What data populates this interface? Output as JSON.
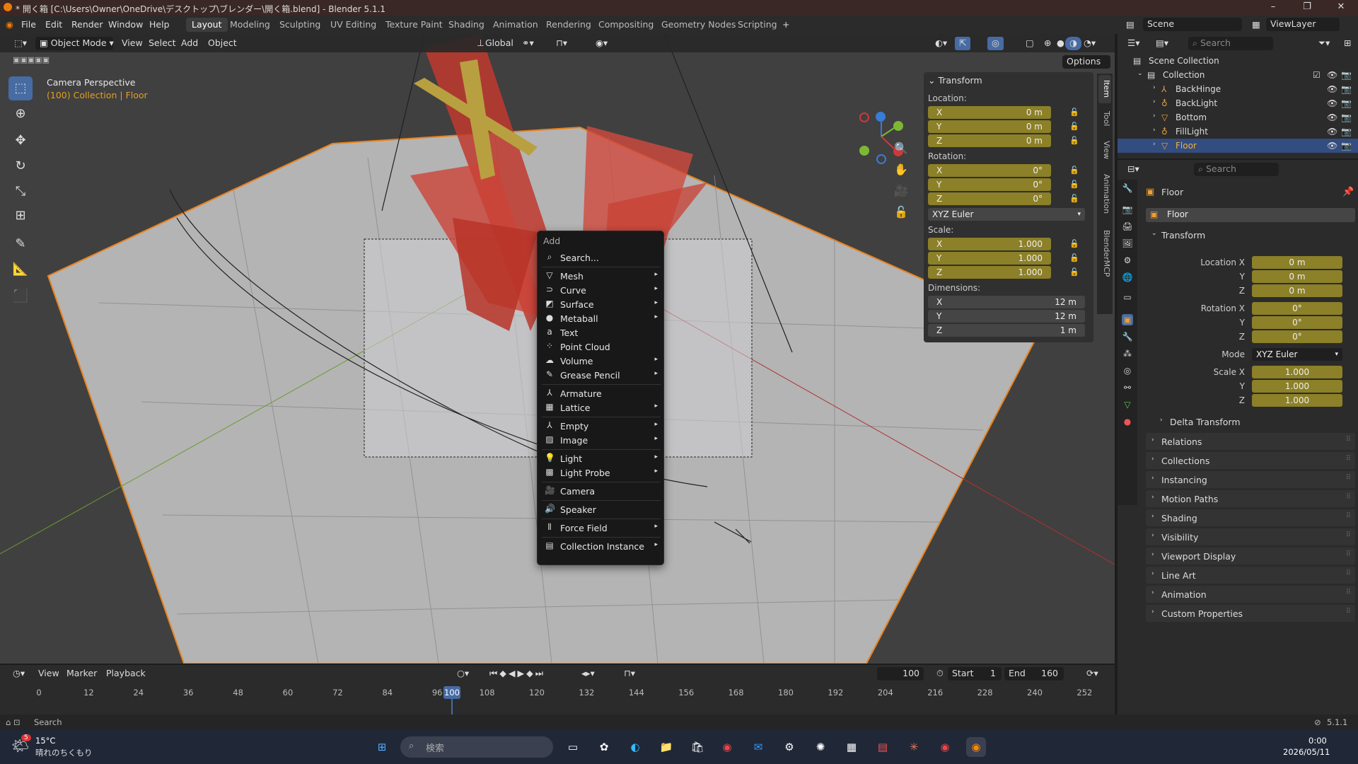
{
  "window": {
    "title": "* 開く箱 [C:\\Users\\Owner\\OneDrive\\デスクトップ\\ブレンダー\\開く箱.blend] - Blender 5.1.1"
  },
  "menubar": {
    "items": [
      "File",
      "Edit",
      "Render",
      "Window",
      "Help"
    ],
    "workspaces": [
      "Layout",
      "Modeling",
      "Sculpting",
      "UV Editing",
      "Texture Paint",
      "Shading",
      "Animation",
      "Rendering",
      "Compositing",
      "Geometry Nodes",
      "Scripting"
    ],
    "active_workspace": "Layout",
    "scene": "Scene",
    "view_layer": "ViewLayer"
  },
  "viewport_header": {
    "mode": "Object Mode",
    "menus": [
      "View",
      "Select",
      "Add",
      "Object"
    ],
    "transform_orientation": "Global",
    "options": "Options"
  },
  "viewport": {
    "camera_line": "Camera Perspective",
    "collection_line_prefix": "(100) Collection | ",
    "collection_line_object": "Floor"
  },
  "npanel": {
    "title": "Transform",
    "location_label": "Location:",
    "location": [
      {
        "axis": "X",
        "value": "0 m"
      },
      {
        "axis": "Y",
        "value": "0 m"
      },
      {
        "axis": "Z",
        "value": "0 m"
      }
    ],
    "rotation_label": "Rotation:",
    "rotation": [
      {
        "axis": "X",
        "value": "0°"
      },
      {
        "axis": "Y",
        "value": "0°"
      },
      {
        "axis": "Z",
        "value": "0°"
      }
    ],
    "rotation_mode": "XYZ Euler",
    "scale_label": "Scale:",
    "scale": [
      {
        "axis": "X",
        "value": "1.000"
      },
      {
        "axis": "Y",
        "value": "1.000"
      },
      {
        "axis": "Z",
        "value": "1.000"
      }
    ],
    "dimensions_label": "Dimensions:",
    "dimensions": [
      {
        "axis": "X",
        "value": "12 m"
      },
      {
        "axis": "Y",
        "value": "12 m"
      },
      {
        "axis": "Z",
        "value": "1 m"
      }
    ],
    "tabs": [
      "Item",
      "Tool",
      "View",
      "Animation",
      "BlenderMCP"
    ]
  },
  "add_menu": {
    "title": "Add",
    "search": "Search...",
    "items": [
      {
        "label": "Mesh",
        "sub": true
      },
      {
        "label": "Curve",
        "sub": true
      },
      {
        "label": "Surface",
        "sub": true
      },
      {
        "label": "Metaball",
        "sub": true
      },
      {
        "label": "Text",
        "sub": false
      },
      {
        "label": "Point Cloud",
        "sub": false
      },
      {
        "label": "Volume",
        "sub": true
      },
      {
        "label": "Grease Pencil",
        "sub": true
      },
      {
        "label": "Armature",
        "sub": false
      },
      {
        "label": "Lattice",
        "sub": true
      },
      {
        "label": "Empty",
        "sub": true
      },
      {
        "label": "Image",
        "sub": true
      },
      {
        "label": "Light",
        "sub": true
      },
      {
        "label": "Light Probe",
        "sub": true
      },
      {
        "label": "Camera",
        "sub": false
      },
      {
        "label": "Speaker",
        "sub": false
      },
      {
        "label": "Force Field",
        "sub": true
      },
      {
        "label": "Collection Instance",
        "sub": true
      }
    ]
  },
  "timeline": {
    "menus": [
      "View",
      "Marker",
      "Playback"
    ],
    "current_frame": "100",
    "start_label": "Start",
    "start": "1",
    "end_label": "End",
    "end": "160",
    "ticks": [
      "0",
      "12",
      "24",
      "36",
      "48",
      "60",
      "72",
      "84",
      "96",
      "108",
      "120",
      "132",
      "144",
      "156",
      "168",
      "180",
      "192",
      "204",
      "216",
      "228",
      "240",
      "252"
    ]
  },
  "statusbar": {
    "search": "Search",
    "version": "5.1.1"
  },
  "outliner": {
    "search_placeholder": "Search",
    "root": "Scene Collection",
    "collection": "Collection",
    "objects": [
      "BackHinge",
      "BackLight",
      "Bottom",
      "FillLight",
      "Floor"
    ],
    "selected": "Floor"
  },
  "properties": {
    "search_placeholder": "Search",
    "object_name": "Floor",
    "object_field": "Floor",
    "transform_title": "Transform",
    "location": [
      {
        "label": "Location X",
        "value": "0 m"
      },
      {
        "label": "Y",
        "value": "0 m"
      },
      {
        "label": "Z",
        "value": "0 m"
      }
    ],
    "rotation": [
      {
        "label": "Rotation X",
        "value": "0°"
      },
      {
        "label": "Y",
        "value": "0°"
      },
      {
        "label": "Z",
        "value": "0°"
      }
    ],
    "mode_label": "Mode",
    "mode": "XYZ Euler",
    "scale": [
      {
        "label": "Scale X",
        "value": "1.000"
      },
      {
        "label": "Y",
        "value": "1.000"
      },
      {
        "label": "Z",
        "value": "1.000"
      }
    ],
    "delta": "Delta Transform",
    "sections": [
      "Relations",
      "Collections",
      "Instancing",
      "Motion Paths",
      "Shading",
      "Visibility",
      "Viewport Display",
      "Line Art",
      "Animation",
      "Custom Properties"
    ]
  },
  "taskbar": {
    "temp": "15°C",
    "weather": "晴れのちくもり",
    "search": "検索",
    "time": "0:00",
    "date": "2026/05/11",
    "badge": "5"
  }
}
